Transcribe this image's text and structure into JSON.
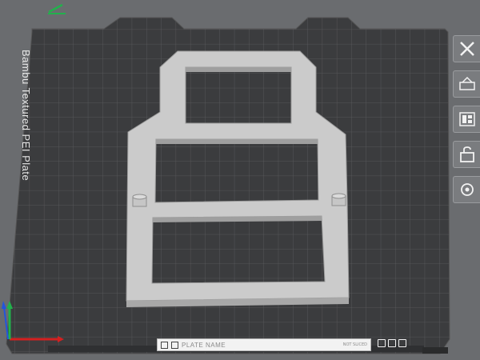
{
  "viewport": {
    "plate_label": "Bambu Textured PEI Plate"
  },
  "toolbar": {
    "items": [
      {
        "name": "close-icon"
      },
      {
        "name": "auto-orient-icon"
      },
      {
        "name": "arrange-icon"
      },
      {
        "name": "lock-icon"
      },
      {
        "name": "settings-icon"
      }
    ]
  },
  "plate_bar": {
    "name": "PLATE NAME",
    "small_text": "NOT SLICED"
  },
  "colors": {
    "background": "#6a6c6f",
    "plate": "#3b3c3e",
    "grid": "#5a5b5d",
    "model": "#c9c9c9",
    "axis_x": "#d42020",
    "axis_y": "#22b14c",
    "axis_z": "#2255dd"
  }
}
